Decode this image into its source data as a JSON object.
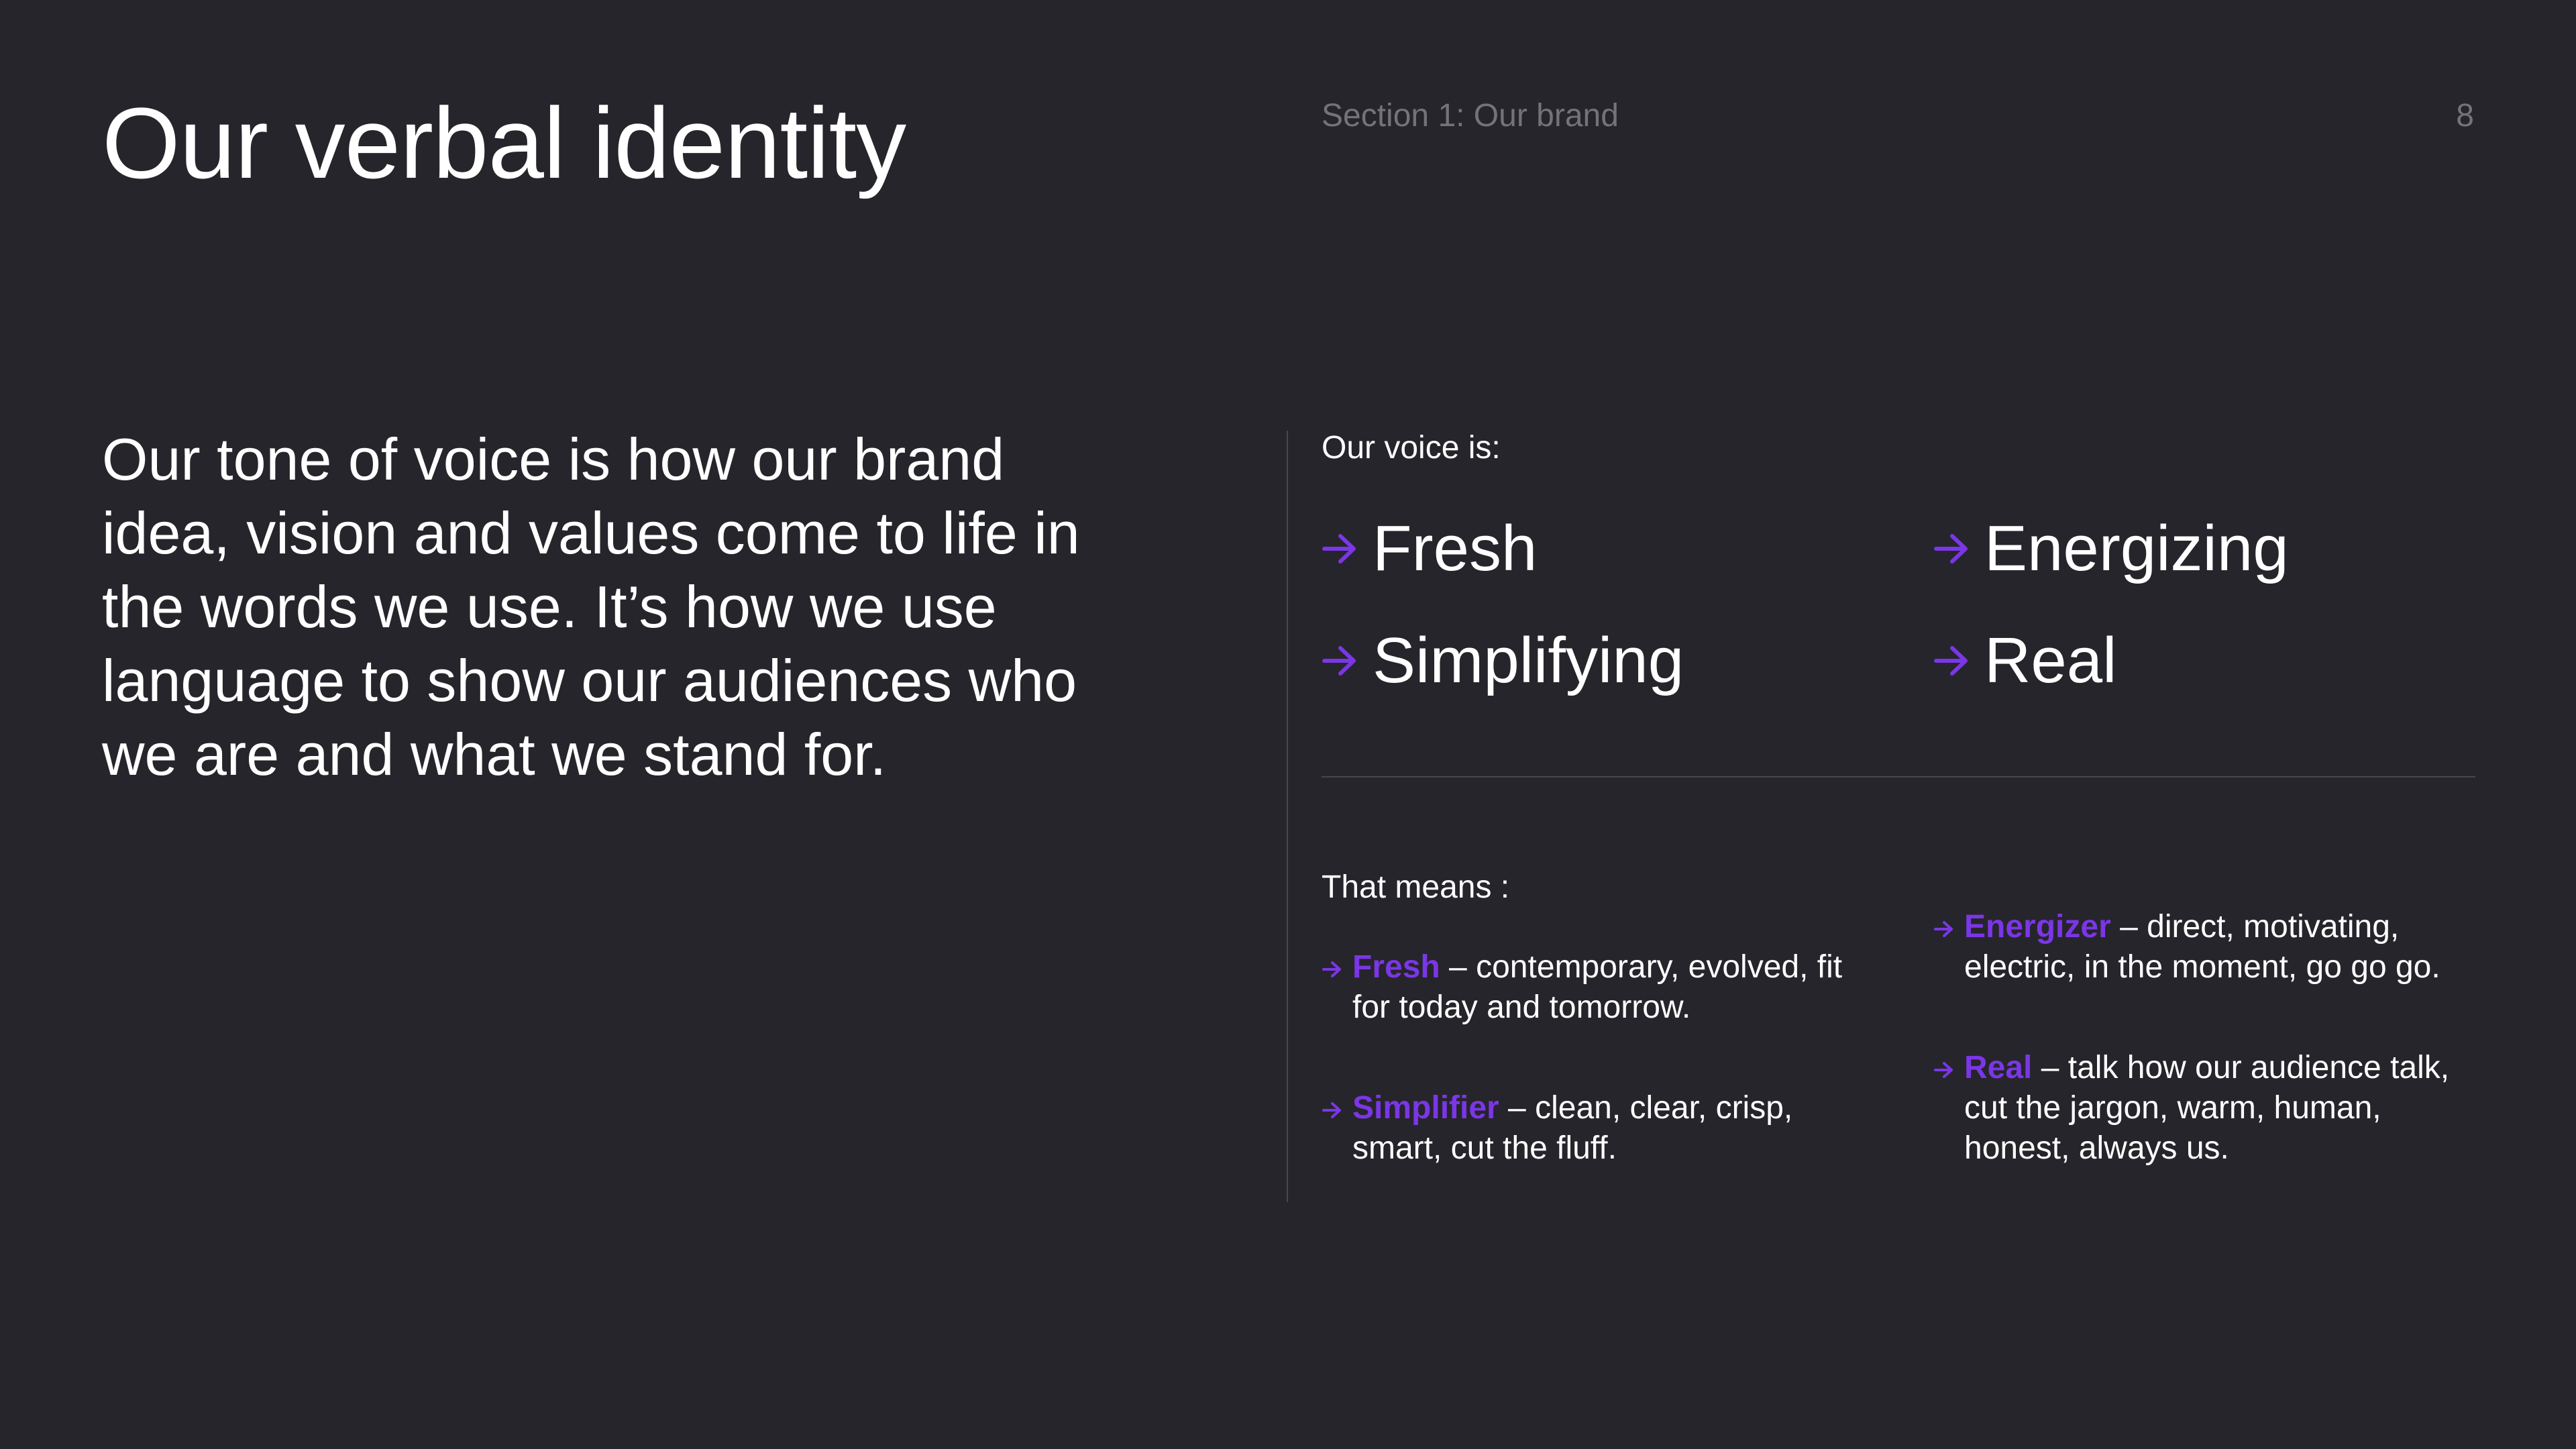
{
  "header": {
    "title": "Our verbal identity",
    "section": "Section 1: Our brand",
    "page_number": "8"
  },
  "intro": {
    "text": "Our tone of voice is how our brand idea, vision and values come to life in the words we use. It’s how we use language to show our audiences who we are and what we stand for."
  },
  "voice": {
    "label": "Our voice is:",
    "traits": [
      "Fresh",
      "Energizing",
      "Simplifying",
      "Real"
    ]
  },
  "means": {
    "label": "That means :",
    "items": [
      {
        "title": "Fresh",
        "description": " – contemporary, evolved, fit for today and tomorrow."
      },
      {
        "title": "Energizer",
        "description": " – direct, motivating, electric, in the moment, go go go."
      },
      {
        "title": "Simplifier",
        "description": " – clean, clear, crisp, smart, cut the fluff."
      },
      {
        "title": "Real",
        "description": " – talk how our audience talk, cut the jargon, warm, human, honest, always us."
      }
    ]
  },
  "colors": {
    "background": "#26252b",
    "accent": "#7b36e6",
    "muted_text": "#74737a",
    "divider": "#48474e"
  },
  "icons": {
    "bullet": "arrow-right-icon"
  }
}
